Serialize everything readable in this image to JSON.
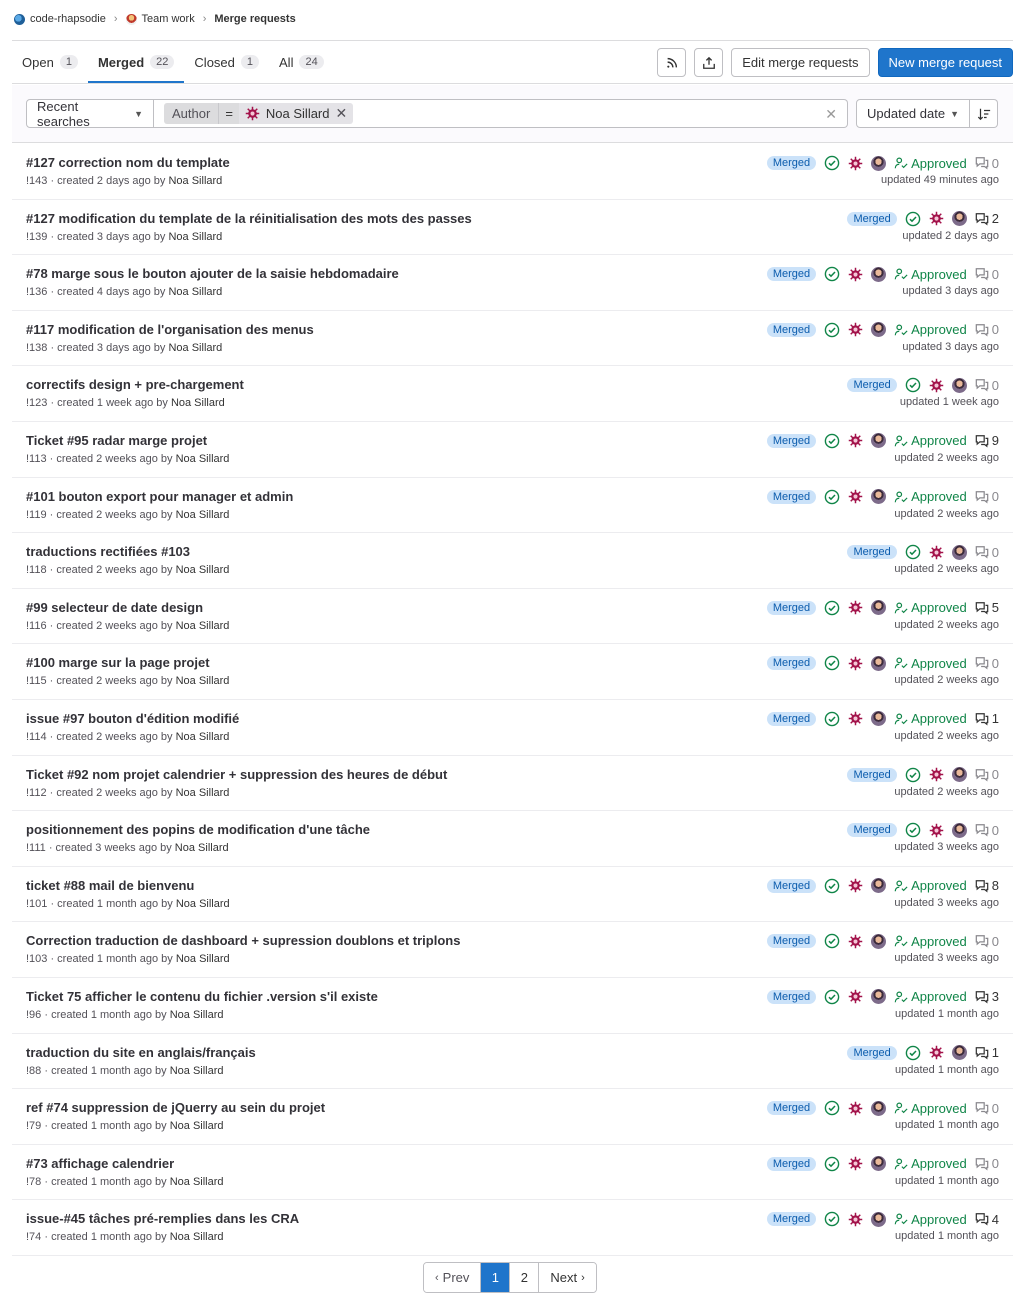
{
  "breadcrumb": {
    "project": "code-rhapsodie",
    "group": "Team work",
    "current": "Merge requests"
  },
  "tabs": [
    {
      "label": "Open",
      "count": "1"
    },
    {
      "label": "Merged",
      "count": "22"
    },
    {
      "label": "Closed",
      "count": "1"
    },
    {
      "label": "All",
      "count": "24"
    }
  ],
  "actions": {
    "rss_icon": "rss-icon",
    "export_icon": "export-icon",
    "edit": "Edit merge requests",
    "new": "New merge request"
  },
  "filter": {
    "recent": "Recent searches",
    "token_name": "Author",
    "token_op": "=",
    "token_value": "Noa Sillard",
    "sort": "Updated date"
  },
  "colors": {
    "accent": "#1f75cb",
    "merged_badge_bg": "#cbe2f9",
    "approved": "#108548"
  },
  "mrs": [
    {
      "title": "#127 correction nom du template",
      "meta": "!143 · created 2 days ago by ",
      "author": "Noa Sillard",
      "status": "Merged",
      "approved": "Approved",
      "comments": "0",
      "updated": "updated 49 minutes ago"
    },
    {
      "title": "#127 modification du template de la réinitialisation des mots des passes",
      "meta": "!139 · created 3 days ago by ",
      "author": "Noa Sillard",
      "status": "Merged",
      "approved": "",
      "comments": "2",
      "updated": "updated 2 days ago"
    },
    {
      "title": "#78 marge sous le bouton ajouter de la saisie hebdomadaire",
      "meta": "!136 · created 4 days ago by ",
      "author": "Noa Sillard",
      "status": "Merged",
      "approved": "Approved",
      "comments": "0",
      "updated": "updated 3 days ago"
    },
    {
      "title": "#117 modification de l'organisation des menus",
      "meta": "!138 · created 3 days ago by ",
      "author": "Noa Sillard",
      "status": "Merged",
      "approved": "Approved",
      "comments": "0",
      "updated": "updated 3 days ago"
    },
    {
      "title": "correctifs design + pre-chargement",
      "meta": "!123 · created 1 week ago by ",
      "author": "Noa Sillard",
      "status": "Merged",
      "approved": "",
      "comments": "0",
      "updated": "updated 1 week ago"
    },
    {
      "title": "Ticket #95 radar marge projet",
      "meta": "!113 · created 2 weeks ago by ",
      "author": "Noa Sillard",
      "status": "Merged",
      "approved": "Approved",
      "comments": "9",
      "updated": "updated 2 weeks ago"
    },
    {
      "title": "#101 bouton export pour manager et admin",
      "meta": "!119 · created 2 weeks ago by ",
      "author": "Noa Sillard",
      "status": "Merged",
      "approved": "Approved",
      "comments": "0",
      "updated": "updated 2 weeks ago"
    },
    {
      "title": "traductions rectifiées #103",
      "meta": "!118 · created 2 weeks ago by ",
      "author": "Noa Sillard",
      "status": "Merged",
      "approved": "",
      "comments": "0",
      "updated": "updated 2 weeks ago"
    },
    {
      "title": "#99 selecteur de date design",
      "meta": "!116 · created 2 weeks ago by ",
      "author": "Noa Sillard",
      "status": "Merged",
      "approved": "Approved",
      "comments": "5",
      "updated": "updated 2 weeks ago"
    },
    {
      "title": "#100 marge sur la page projet",
      "meta": "!115 · created 2 weeks ago by ",
      "author": "Noa Sillard",
      "status": "Merged",
      "approved": "Approved",
      "comments": "0",
      "updated": "updated 2 weeks ago"
    },
    {
      "title": "issue #97 bouton d'édition modifié",
      "meta": "!114 · created 2 weeks ago by ",
      "author": "Noa Sillard",
      "status": "Merged",
      "approved": "Approved",
      "comments": "1",
      "updated": "updated 2 weeks ago"
    },
    {
      "title": "Ticket #92 nom projet calendrier + suppression des heures de début",
      "meta": "!112 · created 2 weeks ago by ",
      "author": "Noa Sillard",
      "status": "Merged",
      "approved": "",
      "comments": "0",
      "updated": "updated 2 weeks ago"
    },
    {
      "title": "positionnement des popins de modification d'une tâche",
      "meta": "!111 · created 3 weeks ago by ",
      "author": "Noa Sillard",
      "status": "Merged",
      "approved": "",
      "comments": "0",
      "updated": "updated 3 weeks ago"
    },
    {
      "title": "ticket #88 mail de bienvenu",
      "meta": "!101 · created 1 month ago by ",
      "author": "Noa Sillard",
      "status": "Merged",
      "approved": "Approved",
      "comments": "8",
      "updated": "updated 3 weeks ago"
    },
    {
      "title": "Correction traduction de dashboard + supression doublons et triplons",
      "meta": "!103 · created 1 month ago by ",
      "author": "Noa Sillard",
      "status": "Merged",
      "approved": "Approved",
      "comments": "0",
      "updated": "updated 3 weeks ago"
    },
    {
      "title": "Ticket 75 afficher le contenu du fichier .version s'il existe",
      "meta": "!96 · created 1 month ago by ",
      "author": "Noa Sillard",
      "status": "Merged",
      "approved": "Approved",
      "comments": "3",
      "updated": "updated 1 month ago"
    },
    {
      "title": "traduction du site en anglais/français",
      "meta": "!88 · created 1 month ago by ",
      "author": "Noa Sillard",
      "status": "Merged",
      "approved": "",
      "comments": "1",
      "updated": "updated 1 month ago"
    },
    {
      "title": "ref #74 suppression de jQuerry au sein du projet",
      "meta": "!79 · created 1 month ago by ",
      "author": "Noa Sillard",
      "status": "Merged",
      "approved": "Approved",
      "comments": "0",
      "updated": "updated 1 month ago"
    },
    {
      "title": "#73 affichage calendrier",
      "meta": "!78 · created 1 month ago by ",
      "author": "Noa Sillard",
      "status": "Merged",
      "approved": "Approved",
      "comments": "0",
      "updated": "updated 1 month ago"
    },
    {
      "title": "issue-#45 tâches pré-remplies dans les CRA",
      "meta": "!74 · created 1 month ago by ",
      "author": "Noa Sillard",
      "status": "Merged",
      "approved": "Approved",
      "comments": "4",
      "updated": "updated 1 month ago"
    }
  ],
  "pagination": {
    "prev": "Prev",
    "pages": [
      "1",
      "2"
    ],
    "next": "Next",
    "current": "1"
  }
}
